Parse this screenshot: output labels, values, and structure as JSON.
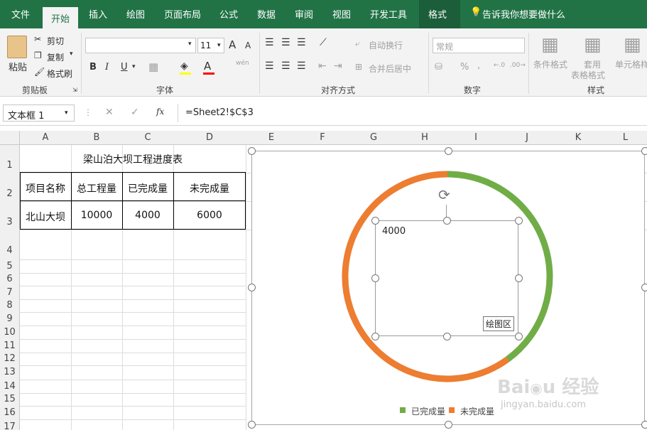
{
  "tabs": [
    "文件",
    "开始",
    "插入",
    "绘图",
    "页面布局",
    "公式",
    "数据",
    "审阅",
    "视图",
    "开发工具",
    "格式"
  ],
  "tell_me": "告诉我你想要做什么",
  "ribbon": {
    "paste": "粘贴",
    "cut": "剪切",
    "copy": "复制",
    "format_painter": "格式刷",
    "clipboard": "剪贴板",
    "font_size": "11",
    "font_group": "字体",
    "wrap_text": "自动换行",
    "merge_center": "合并后居中",
    "alignment": "对齐方式",
    "number_format": "常规",
    "number": "数字",
    "conditional_format": "条件格式",
    "table_format_1": "套用",
    "table_format_2": "表格格式",
    "cell_styles": "单元格样",
    "styles": "样式",
    "bold": "B",
    "italic": "I",
    "underline": "U",
    "grow_font": "A",
    "shrink_font": "A",
    "percent": "%",
    "comma": ",",
    "pinyin": "wén"
  },
  "formula_bar": {
    "name_box": "文本框 1",
    "formula": "=Sheet2!$C$3",
    "fx": "fx"
  },
  "columns": [
    "A",
    "B",
    "C",
    "D",
    "E",
    "F",
    "G",
    "H",
    "I",
    "J",
    "K",
    "L"
  ],
  "rows": [
    "1",
    "2",
    "3",
    "4",
    "5",
    "6",
    "7",
    "8",
    "9",
    "10",
    "11",
    "12",
    "13",
    "14",
    "15",
    "16",
    "17"
  ],
  "table": {
    "title": "梁山泊大坝工程进度表",
    "headers": [
      "项目名称",
      "总工程量",
      "已完成量",
      "未完成量"
    ],
    "row": [
      "北山大坝",
      "10000",
      "4000",
      "6000"
    ]
  },
  "chart_data": {
    "type": "pie",
    "style": "doughnut",
    "categories": [
      "已完成量",
      "未完成量"
    ],
    "values": [
      4000,
      6000
    ],
    "colors": [
      "#70ad47",
      "#ed7d31"
    ],
    "legend": "bottom",
    "textbox_value": "4000",
    "tooltip": "绘图区"
  },
  "watermark": "Baidu 经验 jingyan.baidu.com"
}
